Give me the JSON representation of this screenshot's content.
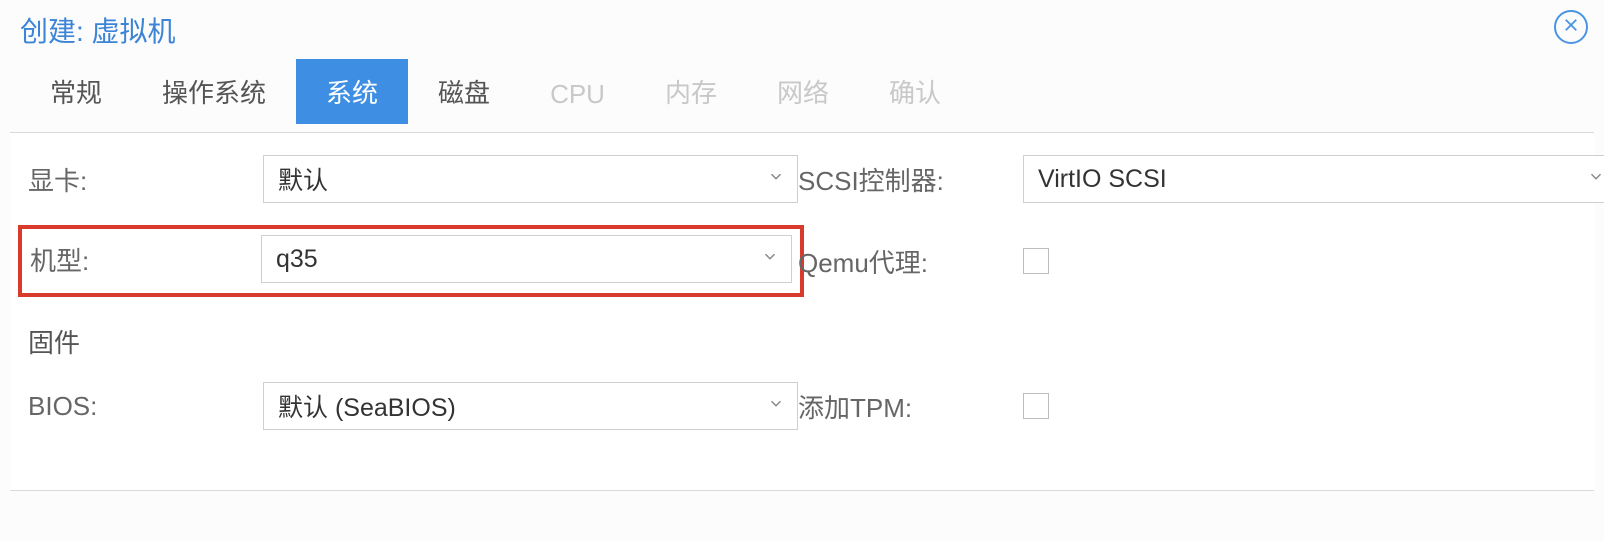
{
  "dialog": {
    "title": "创建: 虚拟机"
  },
  "tabs": [
    {
      "label": "常规",
      "state": "normal"
    },
    {
      "label": "操作系统",
      "state": "normal"
    },
    {
      "label": "系统",
      "state": "active"
    },
    {
      "label": "磁盘",
      "state": "normal"
    },
    {
      "label": "CPU",
      "state": "disabled"
    },
    {
      "label": "内存",
      "state": "disabled"
    },
    {
      "label": "网络",
      "state": "disabled"
    },
    {
      "label": "确认",
      "state": "disabled"
    }
  ],
  "fields": {
    "graphics": {
      "label": "显卡:",
      "value": "默认"
    },
    "scsi_controller": {
      "label": "SCSI控制器:",
      "value": "VirtIO SCSI"
    },
    "machine": {
      "label": "机型:",
      "value": "q35"
    },
    "qemu_agent": {
      "label": "Qemu代理:",
      "checked": false
    },
    "firmware_header": "固件",
    "bios": {
      "label": "BIOS:",
      "value": "默认 (SeaBIOS)"
    },
    "add_tpm": {
      "label": "添加TPM:",
      "checked": false
    }
  }
}
